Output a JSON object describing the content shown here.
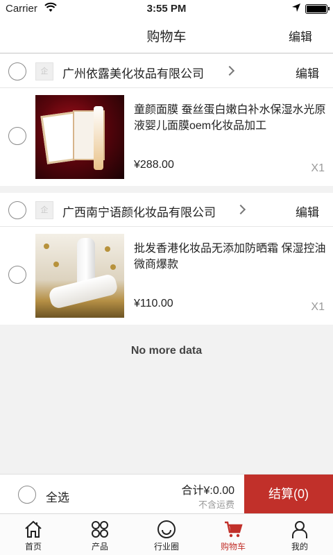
{
  "status_bar": {
    "carrier": "Carrier",
    "time": "3:55 PM"
  },
  "header": {
    "title": "购物车",
    "edit_label": "编辑"
  },
  "shops": [
    {
      "logo_text": "企",
      "name": "广州依露美化妆品有限公司",
      "edit_label": "编辑",
      "items": [
        {
          "title": "童颜面膜 蚕丝蛋白嫩白补水保湿水光原液婴儿面膜oem化妆品加工",
          "price": "¥288.00",
          "quantity": "X1"
        }
      ]
    },
    {
      "logo_text": "企",
      "name": "广西南宁语颜化妆品有限公司",
      "edit_label": "编辑",
      "items": [
        {
          "title": "批发香港化妆品无添加防晒霜 保湿控油 微商爆款",
          "price": "¥110.00",
          "quantity": "X1"
        }
      ]
    }
  ],
  "list_end_text": "No more data",
  "footer": {
    "select_all_label": "全选",
    "total_label": "合计¥:0.00",
    "shipping_note": "不含运费",
    "checkout_label": "结算(0)"
  },
  "tabbar": [
    {
      "label": "首页",
      "icon": "home-icon"
    },
    {
      "label": "产品",
      "icon": "grid-icon"
    },
    {
      "label": "行业圈",
      "icon": "smiley-icon"
    },
    {
      "label": "购物车",
      "icon": "cart-icon",
      "active": true
    },
    {
      "label": "我的",
      "icon": "user-icon"
    }
  ],
  "colors": {
    "accent": "#c1302a",
    "background": "#f2f2f2"
  }
}
